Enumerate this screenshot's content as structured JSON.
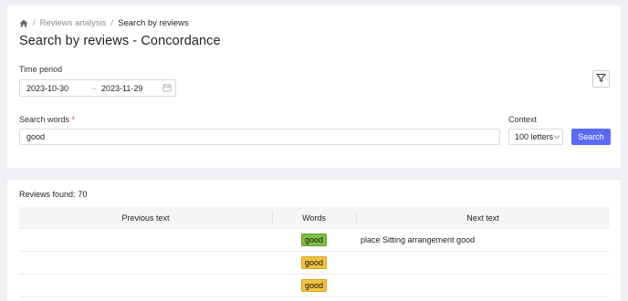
{
  "breadcrumb": {
    "items": [
      {
        "label": "Reviews analysis"
      },
      {
        "label": "Search by reviews"
      }
    ]
  },
  "page_title": "Search by reviews - Concordance",
  "filters": {
    "time_period_label": "Time period",
    "date_start": "2023-10-30",
    "date_end": "2023-11-29",
    "search_words_label": "Search words",
    "required_mark": "*",
    "search_value": "good",
    "context_label": "Context",
    "context_value": "100 letters",
    "search_button": "Search"
  },
  "results": {
    "found_label": "Reviews found:",
    "found_count": "70",
    "columns": {
      "previous": "Previous text",
      "words": "Words",
      "next": "Next text"
    },
    "rows": [
      {
        "previous": "",
        "word": "good",
        "next": "place Sitting arrangement good",
        "tag_color": "#7fbf46"
      },
      {
        "previous": "",
        "word": "good",
        "next": "",
        "tag_color": "#f3c141"
      },
      {
        "previous": "",
        "word": "good",
        "next": "",
        "tag_color": "#f3c141"
      }
    ]
  },
  "colors": {
    "accent": "#5b6af0",
    "tag_green": "#7fbf46",
    "tag_yellow": "#f3c141"
  }
}
